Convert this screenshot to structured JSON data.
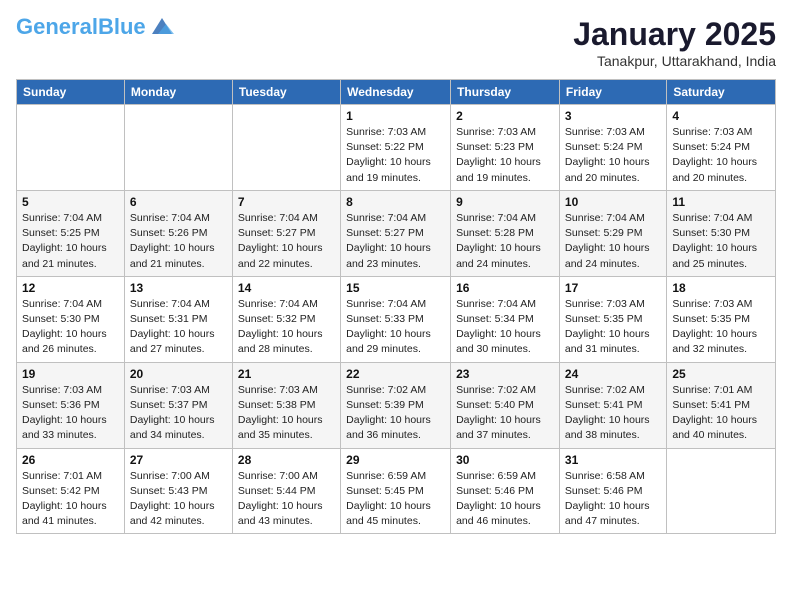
{
  "header": {
    "logo_general": "General",
    "logo_blue": "Blue",
    "month_title": "January 2025",
    "location": "Tanakpur, Uttarakhand, India"
  },
  "weekdays": [
    "Sunday",
    "Monday",
    "Tuesday",
    "Wednesday",
    "Thursday",
    "Friday",
    "Saturday"
  ],
  "weeks": [
    [
      {
        "day": "",
        "info": ""
      },
      {
        "day": "",
        "info": ""
      },
      {
        "day": "",
        "info": ""
      },
      {
        "day": "1",
        "info": "Sunrise: 7:03 AM\nSunset: 5:22 PM\nDaylight: 10 hours\nand 19 minutes."
      },
      {
        "day": "2",
        "info": "Sunrise: 7:03 AM\nSunset: 5:23 PM\nDaylight: 10 hours\nand 19 minutes."
      },
      {
        "day": "3",
        "info": "Sunrise: 7:03 AM\nSunset: 5:24 PM\nDaylight: 10 hours\nand 20 minutes."
      },
      {
        "day": "4",
        "info": "Sunrise: 7:03 AM\nSunset: 5:24 PM\nDaylight: 10 hours\nand 20 minutes."
      }
    ],
    [
      {
        "day": "5",
        "info": "Sunrise: 7:04 AM\nSunset: 5:25 PM\nDaylight: 10 hours\nand 21 minutes."
      },
      {
        "day": "6",
        "info": "Sunrise: 7:04 AM\nSunset: 5:26 PM\nDaylight: 10 hours\nand 21 minutes."
      },
      {
        "day": "7",
        "info": "Sunrise: 7:04 AM\nSunset: 5:27 PM\nDaylight: 10 hours\nand 22 minutes."
      },
      {
        "day": "8",
        "info": "Sunrise: 7:04 AM\nSunset: 5:27 PM\nDaylight: 10 hours\nand 23 minutes."
      },
      {
        "day": "9",
        "info": "Sunrise: 7:04 AM\nSunset: 5:28 PM\nDaylight: 10 hours\nand 24 minutes."
      },
      {
        "day": "10",
        "info": "Sunrise: 7:04 AM\nSunset: 5:29 PM\nDaylight: 10 hours\nand 24 minutes."
      },
      {
        "day": "11",
        "info": "Sunrise: 7:04 AM\nSunset: 5:30 PM\nDaylight: 10 hours\nand 25 minutes."
      }
    ],
    [
      {
        "day": "12",
        "info": "Sunrise: 7:04 AM\nSunset: 5:30 PM\nDaylight: 10 hours\nand 26 minutes."
      },
      {
        "day": "13",
        "info": "Sunrise: 7:04 AM\nSunset: 5:31 PM\nDaylight: 10 hours\nand 27 minutes."
      },
      {
        "day": "14",
        "info": "Sunrise: 7:04 AM\nSunset: 5:32 PM\nDaylight: 10 hours\nand 28 minutes."
      },
      {
        "day": "15",
        "info": "Sunrise: 7:04 AM\nSunset: 5:33 PM\nDaylight: 10 hours\nand 29 minutes."
      },
      {
        "day": "16",
        "info": "Sunrise: 7:04 AM\nSunset: 5:34 PM\nDaylight: 10 hours\nand 30 minutes."
      },
      {
        "day": "17",
        "info": "Sunrise: 7:03 AM\nSunset: 5:35 PM\nDaylight: 10 hours\nand 31 minutes."
      },
      {
        "day": "18",
        "info": "Sunrise: 7:03 AM\nSunset: 5:35 PM\nDaylight: 10 hours\nand 32 minutes."
      }
    ],
    [
      {
        "day": "19",
        "info": "Sunrise: 7:03 AM\nSunset: 5:36 PM\nDaylight: 10 hours\nand 33 minutes."
      },
      {
        "day": "20",
        "info": "Sunrise: 7:03 AM\nSunset: 5:37 PM\nDaylight: 10 hours\nand 34 minutes."
      },
      {
        "day": "21",
        "info": "Sunrise: 7:03 AM\nSunset: 5:38 PM\nDaylight: 10 hours\nand 35 minutes."
      },
      {
        "day": "22",
        "info": "Sunrise: 7:02 AM\nSunset: 5:39 PM\nDaylight: 10 hours\nand 36 minutes."
      },
      {
        "day": "23",
        "info": "Sunrise: 7:02 AM\nSunset: 5:40 PM\nDaylight: 10 hours\nand 37 minutes."
      },
      {
        "day": "24",
        "info": "Sunrise: 7:02 AM\nSunset: 5:41 PM\nDaylight: 10 hours\nand 38 minutes."
      },
      {
        "day": "25",
        "info": "Sunrise: 7:01 AM\nSunset: 5:41 PM\nDaylight: 10 hours\nand 40 minutes."
      }
    ],
    [
      {
        "day": "26",
        "info": "Sunrise: 7:01 AM\nSunset: 5:42 PM\nDaylight: 10 hours\nand 41 minutes."
      },
      {
        "day": "27",
        "info": "Sunrise: 7:00 AM\nSunset: 5:43 PM\nDaylight: 10 hours\nand 42 minutes."
      },
      {
        "day": "28",
        "info": "Sunrise: 7:00 AM\nSunset: 5:44 PM\nDaylight: 10 hours\nand 43 minutes."
      },
      {
        "day": "29",
        "info": "Sunrise: 6:59 AM\nSunset: 5:45 PM\nDaylight: 10 hours\nand 45 minutes."
      },
      {
        "day": "30",
        "info": "Sunrise: 6:59 AM\nSunset: 5:46 PM\nDaylight: 10 hours\nand 46 minutes."
      },
      {
        "day": "31",
        "info": "Sunrise: 6:58 AM\nSunset: 5:46 PM\nDaylight: 10 hours\nand 47 minutes."
      },
      {
        "day": "",
        "info": ""
      }
    ]
  ]
}
